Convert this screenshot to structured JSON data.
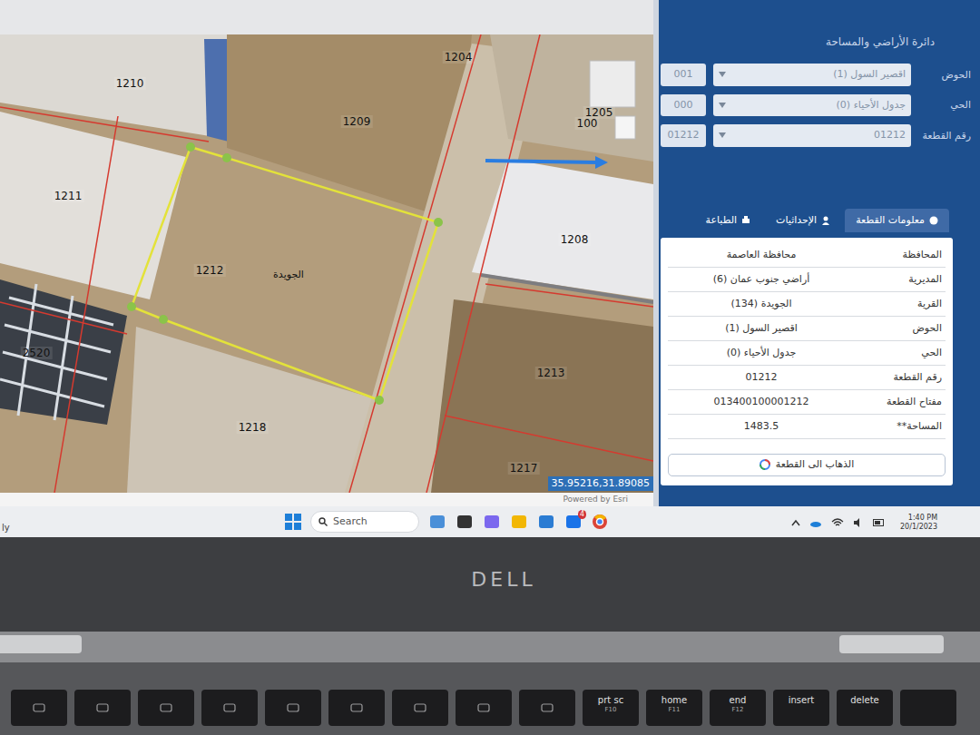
{
  "panel": {
    "title": "دائرة الأراضي والمساحة",
    "filters": [
      {
        "label": "الحوض",
        "code": "001",
        "value": "اقصير السول (1)"
      },
      {
        "label": "الحي",
        "code": "000",
        "value": "جدول الأحياء (0)"
      },
      {
        "label": "رقم القطعة",
        "code": "01212",
        "value": "01212"
      }
    ],
    "tabs": [
      {
        "label": "معلومات القطعة",
        "selected": true
      },
      {
        "label": "الإحداثيات",
        "selected": false
      },
      {
        "label": "الطباعة",
        "selected": false
      }
    ],
    "info": [
      {
        "label": "المحافظة",
        "value": "محافظة العاصمة"
      },
      {
        "label": "المديرية",
        "value": "أراضي جنوب عمان (6)"
      },
      {
        "label": "القرية",
        "value": "الجويدة (134)"
      },
      {
        "label": "الحوض",
        "value": "اقصير السول (1)"
      },
      {
        "label": "الحي",
        "value": "جدول الأحياء (0)"
      },
      {
        "label": "رقم القطعة",
        "value": "01212"
      },
      {
        "label": "مفتاح القطعة",
        "value": "013400100001212"
      },
      {
        "label": "المساحة**",
        "value": "1483.5"
      }
    ],
    "button": "الذهاب الى القطعة"
  },
  "map": {
    "parcel_labels": [
      "1210",
      "1209",
      "1204",
      "1205",
      "100",
      "1211",
      "1212",
      "1208",
      "1213",
      "2520",
      "1218",
      "1217"
    ],
    "place_label": "الجويدة",
    "coordinates": "35.95216,31.89085",
    "attribution": "Powered by Esri"
  },
  "taskbar": {
    "fragment": "ly",
    "search": "Search",
    "mail_badge": "4",
    "time": "1:40 PM",
    "date": "20/1/2023"
  },
  "laptop": {
    "brand": "DELL",
    "keys": [
      {
        "label": "prt sc",
        "sub": "F10"
      },
      {
        "label": "home",
        "sub": "F11"
      },
      {
        "label": "end",
        "sub": "F12"
      },
      {
        "label": "insert"
      },
      {
        "label": "delete"
      }
    ]
  }
}
